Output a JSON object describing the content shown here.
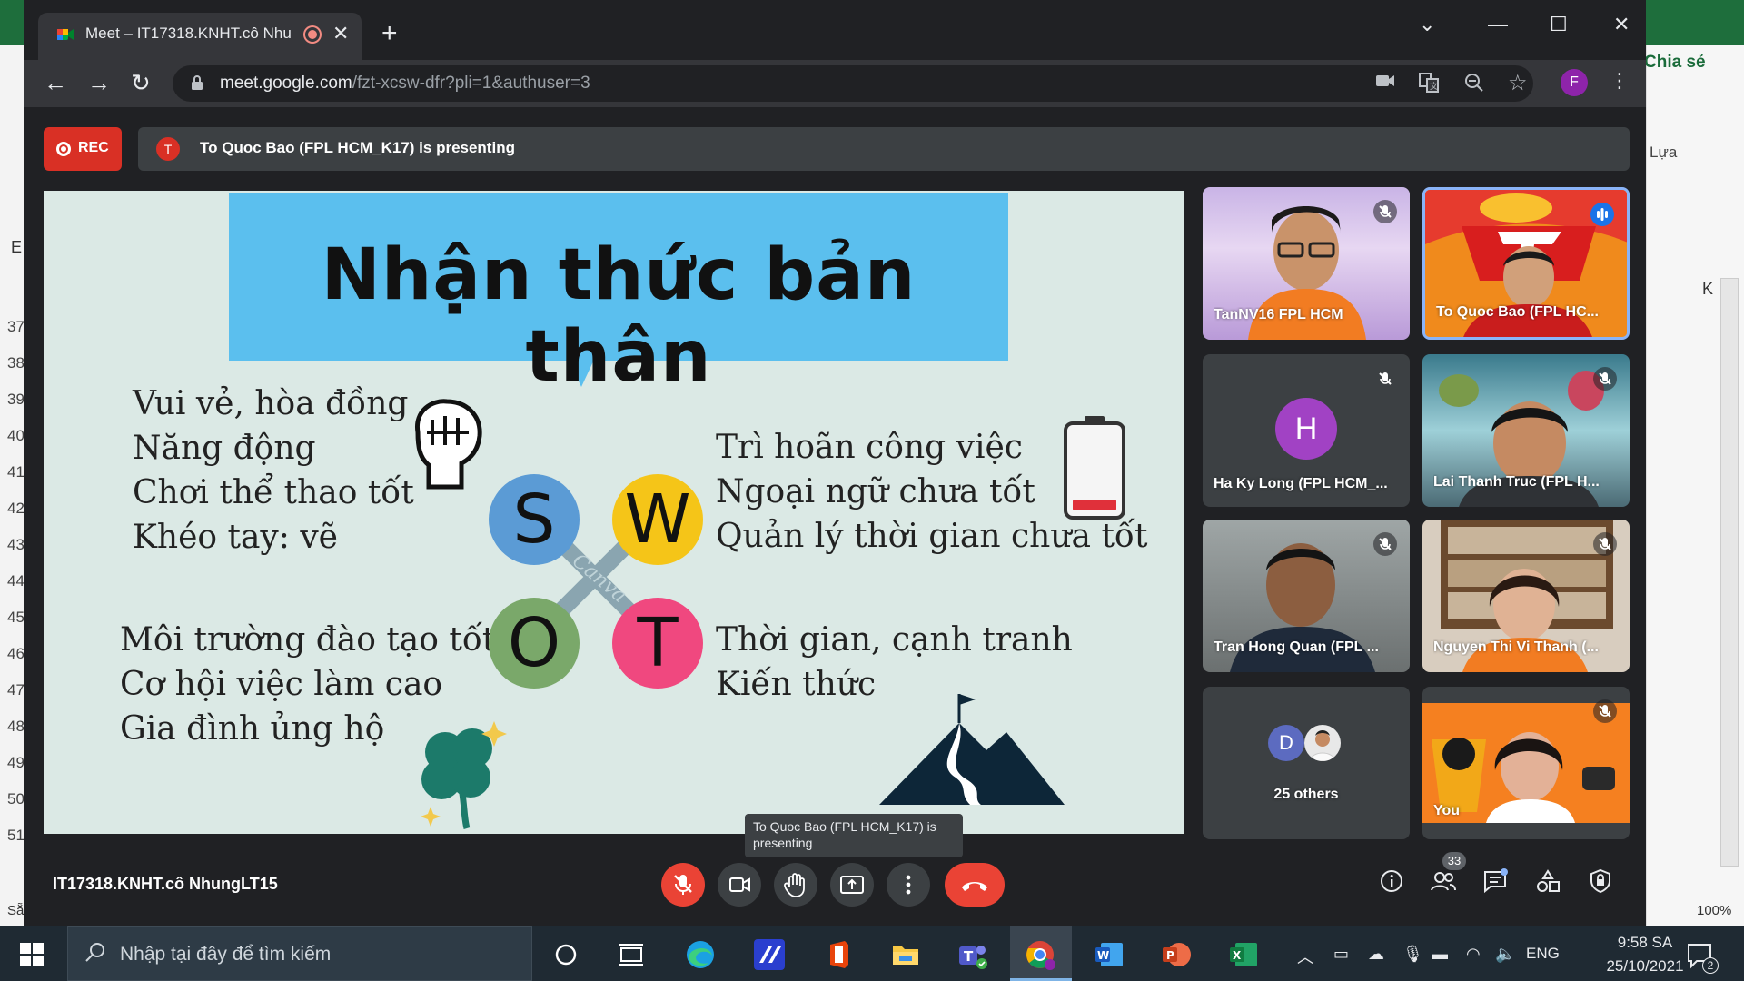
{
  "excel": {
    "share_label": "Chia sẻ",
    "row_numbers": [
      "37",
      "38",
      "39",
      "40",
      "41",
      "42",
      "43",
      "44",
      "45",
      "46",
      "47",
      "48",
      "49",
      "50",
      "51"
    ],
    "column_label": "K",
    "right_label": "Lựa",
    "zoom": "100%",
    "sheet_label": "Sẵ",
    "cell_label": "E"
  },
  "browser": {
    "tab_title": "Meet – IT17318.KNHT.cô Nhu",
    "url_host": "meet.google.com",
    "url_path": "/fzt-xcsw-dfr?pli=1&authuser=3",
    "profile_initial": "F"
  },
  "meet": {
    "rec_label": "REC",
    "presenter_initial": "T",
    "presenting_text": "To Quoc Bao (FPL HCM_K17) is presenting",
    "meeting_code": "IT17318.KNHT.cô NhungLT15",
    "tooltip": "To Quoc Bao (FPL HCM_K17) is presenting",
    "participant_count": "33",
    "others_initial": "D",
    "others_label": "25 others",
    "tiles": [
      {
        "name": "TanNV16 FPL HCM"
      },
      {
        "name": "To Quoc Bao (FPL HC..."
      },
      {
        "name": "Ha Ky Long (FPL HCM_...",
        "initial": "H"
      },
      {
        "name": "Lai Thanh Truc (FPL H..."
      },
      {
        "name": "Tran Hong Quan (FPL ..."
      },
      {
        "name": "Nguyen Thi Vi Thanh (..."
      },
      {
        "name": "You"
      }
    ]
  },
  "slide": {
    "title": "Nhận thức bản thân",
    "strengths": [
      "Vui vẻ, hòa đồng",
      "Năng động",
      "Chơi thể thao tốt",
      "Khéo tay: vẽ"
    ],
    "weaknesses": [
      "Trì hoãn công việc",
      "Ngoại ngữ chưa tốt",
      "Quản lý thời gian chưa tốt"
    ],
    "opportunities": [
      "Môi trường đào tạo tốt",
      "Cơ hội việc làm cao",
      "Gia đình ủng hộ"
    ],
    "threats": [
      "Thời gian, cạnh tranh",
      "Kiến thức"
    ],
    "swot": {
      "s": "S",
      "w": "W",
      "o": "O",
      "t": "T"
    },
    "watermark": "Canva",
    "colors": {
      "s": "#5b9bd5",
      "w": "#f5c518",
      "o": "#7aa86a",
      "t": "#f0487f",
      "title_bg": "#5bbfee",
      "slide_bg": "#dbe9e5"
    }
  },
  "taskbar": {
    "search_placeholder": "Nhập tại đây để tìm kiếm",
    "language": "ENG",
    "time": "9:58 SA",
    "date": "25/10/2021",
    "notifications": "2"
  }
}
